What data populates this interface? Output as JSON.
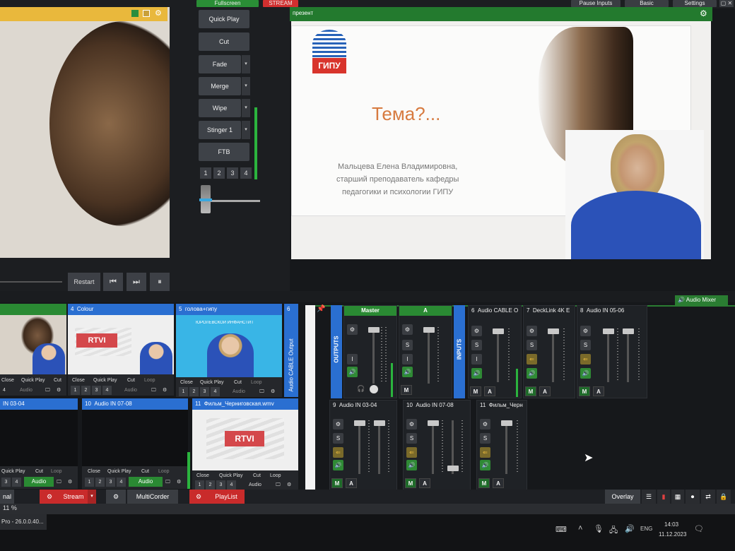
{
  "topbar": {
    "fullscreen": "Fullscreen",
    "stream": "STREAM",
    "pause_inputs": "Pause Inputs",
    "basic": "Basic",
    "settings": "Settings"
  },
  "preview": {
    "restart": "Restart"
  },
  "transitions": {
    "buttons": [
      "Quick Play",
      "Cut",
      "Fade",
      "Merge",
      "Wipe",
      "Stinger 1",
      "FTB"
    ],
    "numbers": [
      "1",
      "2",
      "3",
      "4"
    ]
  },
  "output": {
    "title": "презент",
    "slide": {
      "logo_text": "ГИПУ",
      "heading": "Тема?...",
      "line1": "Мальцева Елена Владимировна,",
      "line2": "старший преподаватель кафедры",
      "line3": "педагогики и психологии ГИПУ"
    }
  },
  "audio_mixer_tab": "Audio Mixer",
  "inputs": [
    {
      "num": "4",
      "title": "Colour",
      "controls": [
        "Close",
        "Quick Play",
        "Cut",
        "Loop"
      ],
      "numbers": [
        "1",
        "2",
        "3",
        "4"
      ],
      "audio": "Audio"
    },
    {
      "num": "5",
      "title": "голова+гипу",
      "controls": [
        "Close",
        "Quick Play",
        "Cut",
        "Loop"
      ],
      "numbers": [
        "1",
        "2",
        "3",
        "4"
      ],
      "audio": "Audio",
      "banner": "ЮРОЛЕВСКОЙ ИНФАНСТИТ"
    },
    {
      "num": "6",
      "title": "Audio CABLE Output"
    },
    {
      "num": "",
      "title": "IN 03-04",
      "controls": [
        "Quick Play",
        "Cut",
        "Loop"
      ],
      "numbers": [
        "3",
        "4"
      ],
      "audio": "Audio"
    },
    {
      "num": "10",
      "title": "Audio IN 07-08",
      "controls": [
        "Close",
        "Quick Play",
        "Cut",
        "Loop"
      ],
      "numbers": [
        "1",
        "2",
        "3",
        "4"
      ],
      "audio": "Audio"
    },
    {
      "num": "11",
      "title": "Фильм_Черниговская.wmv",
      "controls": [
        "Close",
        "Quick Play",
        "Cut",
        "Loop"
      ],
      "numbers": [
        "1",
        "2",
        "3",
        "4"
      ],
      "audio": "Audio"
    }
  ],
  "left_partial": {
    "controls": [
      "Close",
      "Quick Play",
      "Cut"
    ],
    "numbers": [
      "4"
    ],
    "audio": "Audio"
  },
  "rtvi_logo": "RTVI",
  "mixer": {
    "outputs_label": "OUTPUTS",
    "inputs_label": "INPUTS",
    "master": "Master",
    "a": "A",
    "channels_top": [
      {
        "num": "6",
        "name": "Audio CABLE O"
      },
      {
        "num": "7",
        "name": "DeckLink 4K E"
      },
      {
        "num": "8",
        "name": "Audio IN 05-06"
      }
    ],
    "channels_bottom": [
      {
        "num": "9",
        "name": "Audio IN 03-04"
      },
      {
        "num": "10",
        "name": "Audio IN 07-08"
      },
      {
        "num": "11",
        "name": "Фильм_Черн"
      }
    ],
    "s": "S",
    "m": "M",
    "a_btn": "A",
    "i": "I"
  },
  "bottom": {
    "nal": "nal",
    "stream": "Stream",
    "multicorder": "MultiCorder",
    "playlist": "PlayList",
    "overlay": "Overlay",
    "zoom": "11 %"
  },
  "taskbar": {
    "app": "Pro - 26.0.0.40...",
    "lang": "ENG",
    "time": "14:03",
    "date": "11.12.2023"
  },
  "colors": {
    "accent_green": "#237a2e",
    "accent_blue": "#2a6fd1",
    "accent_red": "#d93232",
    "preview_yellow": "#e9b83c"
  }
}
